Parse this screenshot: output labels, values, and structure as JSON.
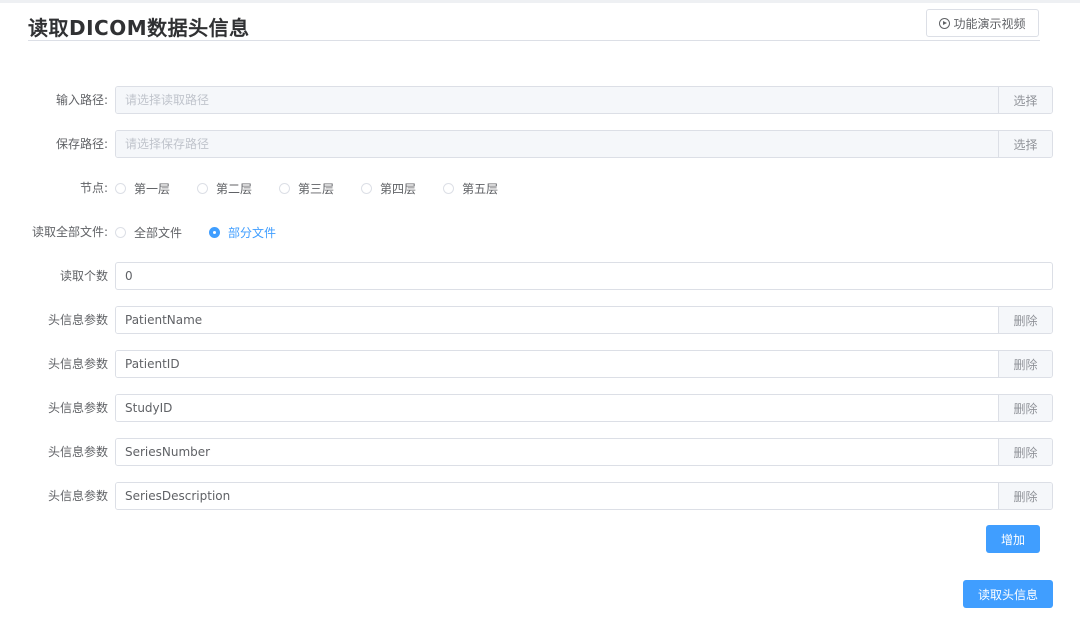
{
  "header": {
    "title": "读取DICOM数据头信息",
    "demo_button": "功能演示视频",
    "demo_icon": "play-circle-icon"
  },
  "input_path": {
    "label": "输入路径:",
    "placeholder": "请选择读取路径",
    "button": "选择"
  },
  "save_path": {
    "label": "保存路径:",
    "placeholder": "请选择保存路径",
    "button": "选择"
  },
  "node": {
    "label": "节点:",
    "options": [
      "第一层",
      "第二层",
      "第三层",
      "第四层",
      "第五层"
    ],
    "selected": null
  },
  "read_all": {
    "label": "读取全部文件:",
    "options": [
      "全部文件",
      "部分文件"
    ],
    "selected": "部分文件"
  },
  "read_count": {
    "label": "读取个数",
    "value": "0"
  },
  "header_params": {
    "label": "头信息参数",
    "delete_label": "删除",
    "items": [
      "PatientName",
      "PatientID",
      "StudyID",
      "SeriesNumber",
      "SeriesDescription"
    ]
  },
  "add_button": "增加",
  "read_button": "读取头信息",
  "colors": {
    "primary": "#409eff",
    "border": "#dcdfe6",
    "text": "#606266",
    "placeholder": "#c0c4cc",
    "append_bg": "#f5f7fa"
  }
}
